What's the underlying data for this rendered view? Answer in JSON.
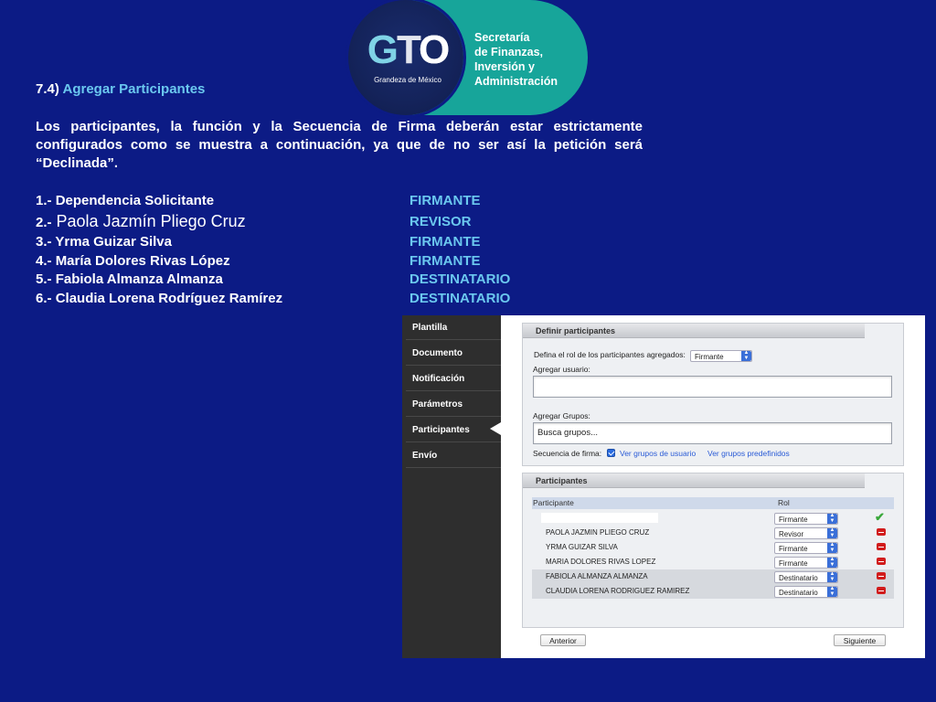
{
  "logo": {
    "mark": "GTO",
    "tagline": "Grandeza de México",
    "lines": [
      "Secretaría",
      "de Finanzas,",
      "Inversión y",
      "Administración"
    ]
  },
  "section": {
    "number": "7.4)",
    "title": "Agregar Participantes"
  },
  "intro": "Los participantes, la función y la Secuencia de Firma deberán estar estrictamente configurados como se muestra a continuación, ya que de no ser así la petición será “Declinada”.",
  "participants": [
    {
      "num": "1.-",
      "name": "Dependencia Solicitante",
      "role": "FIRMANTE"
    },
    {
      "num": "2.-",
      "name": "Paola Jazmín Pliego Cruz",
      "role": "REVISOR"
    },
    {
      "num": "3.-",
      "name": "Yrma Guizar Silva",
      "role": "FIRMANTE"
    },
    {
      "num": "4.-",
      "name": "María Dolores Rivas López",
      "role": "FIRMANTE"
    },
    {
      "num": "5.-",
      "name": "Fabiola Almanza Almanza",
      "role": "DESTINATARIO"
    },
    {
      "num": "6.-",
      "name": "Claudia Lorena Rodríguez Ramírez",
      "role": "DESTINATARIO"
    }
  ],
  "app": {
    "sidebar": [
      "Plantilla",
      "Documento",
      "Notificación",
      "Parámetros",
      "Participantes",
      "Envío"
    ],
    "define_panel": {
      "title": "Definir participantes",
      "role_label": "Defina el rol de los participantes agregados:",
      "role_value": "Firmante",
      "add_user_label": "Agregar usuario:",
      "add_groups_label": "Agregar Grupos:",
      "groups_placeholder": "Busca grupos...",
      "sequence_label": "Secuencia de firma:",
      "link_user_groups": "Ver grupos de usuario",
      "link_predefined_groups": "Ver grupos predefinidos"
    },
    "participants_panel": {
      "title": "Participantes",
      "col_participant": "Participante",
      "col_role": "Rol",
      "rows": [
        {
          "name": "",
          "role": "Firmante"
        },
        {
          "name": "PAOLA JAZMIN PLIEGO CRUZ",
          "role": "Revisor"
        },
        {
          "name": "YRMA GUIZAR SILVA",
          "role": "Firmante"
        },
        {
          "name": "MARIA DOLORES RIVAS LOPEZ",
          "role": "Firmante"
        },
        {
          "name": "FABIOLA ALMANZA ALMANZA",
          "role": "Destinatario"
        },
        {
          "name": "CLAUDIA LORENA RODRIGUEZ RAMIREZ",
          "role": "Destinatario"
        }
      ]
    },
    "buttons": {
      "prev": "Anterior",
      "next": "Siguiente"
    }
  }
}
